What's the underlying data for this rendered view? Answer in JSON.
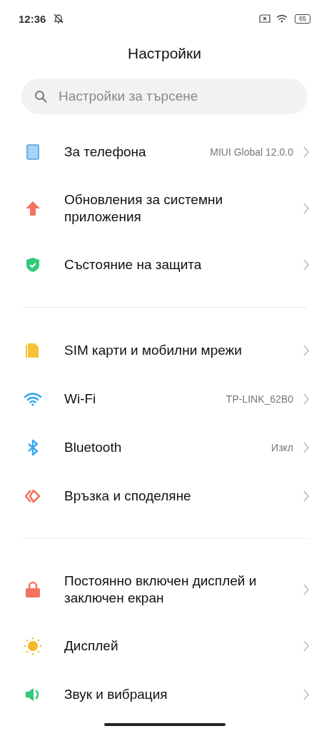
{
  "status_bar": {
    "time": "12:36",
    "battery": "65"
  },
  "title": "Настройки",
  "search": {
    "placeholder": "Настройки за търсене"
  },
  "groups": [
    {
      "items": [
        {
          "kind": "phone",
          "label": "За телефона",
          "value": "MIUI Global 12.0.0"
        },
        {
          "kind": "update",
          "label": "Обновления за системни приложения"
        },
        {
          "kind": "shield",
          "label": "Състояние на защита"
        }
      ]
    },
    {
      "items": [
        {
          "kind": "sim",
          "label": "SIM карти и мобилни мрежи"
        },
        {
          "kind": "wifi",
          "label": "Wi-Fi",
          "value": "TP-LINK_62B0"
        },
        {
          "kind": "bluetooth",
          "label": "Bluetooth",
          "value": "Изкл"
        },
        {
          "kind": "share",
          "label": "Връзка и споделяне"
        }
      ]
    },
    {
      "items": [
        {
          "kind": "lock",
          "label": "Постоянно включен дисплей и заключен екран"
        },
        {
          "kind": "sun",
          "label": "Дисплей"
        },
        {
          "kind": "sound",
          "label": "Звук и вибрация"
        }
      ]
    }
  ]
}
